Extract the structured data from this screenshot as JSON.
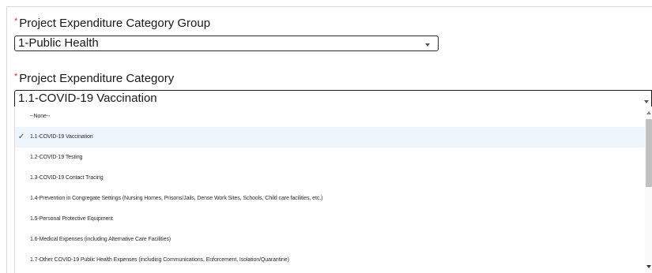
{
  "group_field": {
    "required_marker": "*",
    "label": "Project Expenditure Category Group",
    "value": "1-Public Health"
  },
  "category_field": {
    "required_marker": "*",
    "label": "Project Expenditure Category",
    "value": "1.1-COVID-19 Vaccination"
  },
  "dropdown": {
    "selected_check": "✓",
    "options": [
      "--None--",
      "1.1-COVID-19 Vaccination",
      "1.2-COVID-19 Testing",
      "1.3-COVID-19 Contact Tracing",
      "1.4-Prevention in Congregate Settings (Nursing Homes, Prisons/Jails, Dense Work Sites, Schools, Child care facilities, etc.)",
      "1.5-Personal Protective Equipment",
      "1.6-Medical Expenses (including Alternative Care Facilities)",
      "1.7-Other COVID-19 Public Health Expenses (including Communications, Enforcement, Isolation/Quarantine)"
    ],
    "selected_index": 1,
    "scroll_position_fraction": 0.0
  },
  "colors": {
    "required": "#c23934",
    "selected_row": "#eef4fb"
  }
}
